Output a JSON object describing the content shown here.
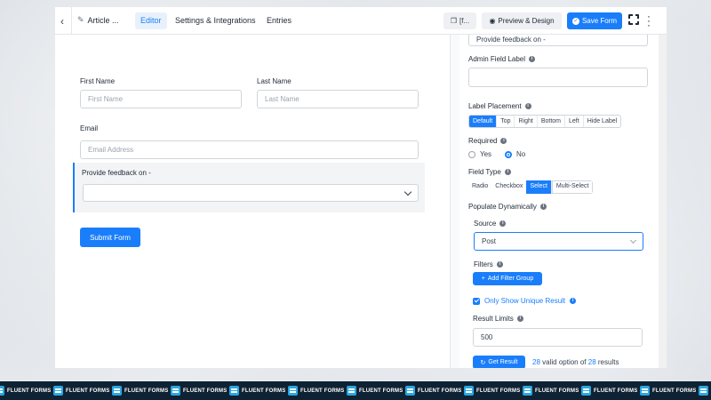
{
  "topbar": {
    "article_title": "Article ...",
    "tabs": [
      {
        "label": "Editor",
        "active": true
      },
      {
        "label": "Settings & Integrations",
        "active": false
      },
      {
        "label": "Entries",
        "active": false
      }
    ],
    "shortcode_label": "[f...",
    "preview_label": "Preview & Design",
    "save_label": "Save Form"
  },
  "form": {
    "first_name_label": "First Name",
    "first_name_placeholder": "First Name",
    "last_name_label": "Last Name",
    "last_name_placeholder": "Last Name",
    "email_label": "Email",
    "email_placeholder": "Email Address",
    "feedback_label": "Provide feedback on -",
    "submit_label": "Submit Form"
  },
  "panel": {
    "top_value": "Provide feedback on -",
    "admin_label": "Admin Field Label",
    "admin_value": "",
    "label_placement": "Label Placement",
    "placement_options": [
      "Default",
      "Top",
      "Right",
      "Bottom",
      "Left",
      "Hide Label"
    ],
    "placement_selected": "Default",
    "required": "Required",
    "required_yes": "Yes",
    "required_no": "No",
    "required_selected": "No",
    "field_type": "Field Type",
    "field_type_options": [
      "Radio",
      "Checkbox",
      "Select",
      "Multi-Select"
    ],
    "field_type_selected": "Select",
    "populate": "Populate Dynamically",
    "source": "Source",
    "source_value": "Post",
    "filters": "Filters",
    "add_filter": "Add Filter Group",
    "unique": "Only Show Unique Result",
    "limits": "Result Limits",
    "limits_value": "500",
    "get_result": "Get Result",
    "result_count": "28",
    "result_mid": "valid option of",
    "result_total": "28",
    "result_end": "results"
  },
  "footer": {
    "brand": "FLUENT FORMS"
  },
  "colors": {
    "accent": "#1a7efb",
    "footer_bg": "#0f2234"
  }
}
